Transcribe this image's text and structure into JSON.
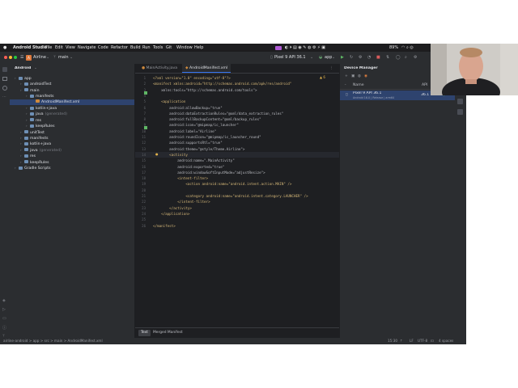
{
  "menubar": {
    "items": [
      "Android Studio",
      "File",
      "Edit",
      "View",
      "Navigate",
      "Code",
      "Refactor",
      "Build",
      "Run",
      "Tools",
      "Git",
      "Window",
      "Help"
    ],
    "battery": "89%"
  },
  "titlebar": {
    "project": "Airline",
    "branch": "main",
    "device": "Pixel 9 API 36.1",
    "run_config": "app"
  },
  "project_panel": {
    "view": "Android",
    "tree": [
      {
        "label": "app",
        "indent": 0,
        "type": "folder"
      },
      {
        "label": "androidTest",
        "indent": 1,
        "type": "folder"
      },
      {
        "label": "main",
        "indent": 1,
        "type": "folder"
      },
      {
        "label": "manifests",
        "indent": 2,
        "type": "folder"
      },
      {
        "label": "AndroidManifest.xml",
        "indent": 3,
        "type": "file",
        "selected": true
      },
      {
        "label": "kotlin+java",
        "indent": 2,
        "type": "folder"
      },
      {
        "label": "java",
        "suffix": "(generated)",
        "indent": 2,
        "type": "folder"
      },
      {
        "label": "res",
        "indent": 2,
        "type": "folder"
      },
      {
        "label": "keepRules",
        "indent": 2,
        "type": "folder"
      },
      {
        "label": "unitTest",
        "indent": 1,
        "type": "folder"
      },
      {
        "label": "manifests",
        "indent": 1,
        "type": "folder"
      },
      {
        "label": "kotlin+java",
        "indent": 1,
        "type": "folder"
      },
      {
        "label": "java",
        "suffix": "(generated)",
        "indent": 1,
        "type": "folder"
      },
      {
        "label": "res",
        "indent": 1,
        "type": "folder"
      },
      {
        "label": "keepRules",
        "indent": 1,
        "type": "folder"
      },
      {
        "label": "Gradle Scripts",
        "indent": 0,
        "type": "folder"
      }
    ]
  },
  "editor": {
    "tabs": [
      "MainActivity.java",
      "AndroidManifest.xml"
    ],
    "active_tab": 1,
    "warnings": "▲ 6",
    "bottom_tabs": [
      "Text",
      "Merged Manifest"
    ],
    "lines": [
      "<?xml version=\"1.0\" encoding=\"utf-8\"?>",
      "<manifest xmlns:android=\"http://schemas.android.com/apk/res/android\"",
      "    xmlns:tools=\"http://schemas.android.com/tools\">",
      "",
      "    <application",
      "        android:allowBackup=\"true\"",
      "        android:dataExtractionRules=\"@xml/data_extraction_rules\"",
      "        android:fullBackupContent=\"@xml/backup_rules\"",
      "        android:icon=\"@mipmap/ic_launcher\"",
      "        android:label=\"Airline\"",
      "        android:roundIcon=\"@mipmap/ic_launcher_round\"",
      "        android:supportsRtl=\"true\"",
      "        android:theme=\"@style/Theme.Airline\">",
      "        <activity",
      "            android:name=\".MainActivity\"",
      "            android:exported=\"true\"",
      "            android:windowSoftInputMode=\"adjustResize\">",
      "            <intent-filter>",
      "                <action android:name=\"android.intent.action.MAIN\" />",
      "",
      "                <category android:name=\"android.intent.category.LAUNCHER\" />",
      "            </intent-filter>",
      "        </activity>",
      "    </application>",
      "",
      "</manifest>"
    ]
  },
  "device_manager": {
    "title": "Device Manager",
    "col_name": "Name",
    "col_api": "API",
    "device_name": "Pixel 9 API 36.1",
    "device_sub": "Android 16.0 | Release | arm64",
    "device_api": "36.1",
    "device_type": "Virtual"
  },
  "statusbar": {
    "breadcrumb": "airline-android > app > src > main > AndroidManifest.xml",
    "position": "15:30",
    "line_sep": "LF",
    "encoding": "UTF-8",
    "indent": "4 spaces"
  }
}
